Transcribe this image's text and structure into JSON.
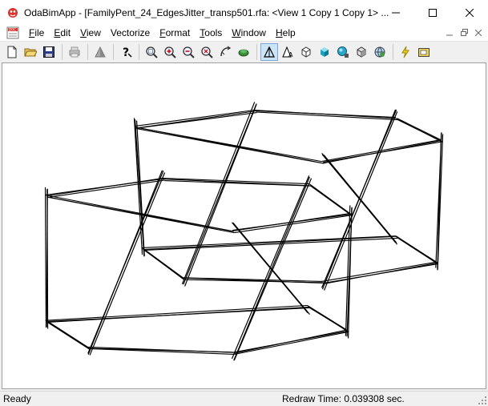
{
  "window": {
    "title": "OdaBimApp - [FamilyPent_24_EdgesJitter_transp501.rfa: <View 1 Copy 1 Copy 1> ...",
    "minimize_icon": "minimize-icon",
    "maximize_icon": "maximize-icon",
    "close_icon": "close-icon"
  },
  "menu": {
    "items": [
      {
        "key": "F",
        "rest": "ile"
      },
      {
        "key": "E",
        "rest": "dit"
      },
      {
        "key": "V",
        "rest": "iew"
      },
      {
        "key": "",
        "rest": "Vectorize"
      },
      {
        "key": "F",
        "rest": "ormat",
        "underline_index": 1
      },
      {
        "key": "T",
        "rest": "ools"
      },
      {
        "key": "W",
        "rest": "indow"
      },
      {
        "key": "H",
        "rest": "elp"
      }
    ]
  },
  "toolbar": {
    "buttons": [
      "new-icon",
      "open-icon",
      "save-icon",
      "print-icon",
      "render-icon",
      "help-icon",
      "zoom-window-icon",
      "zoom-in-icon",
      "zoom-out-icon",
      "zoom-extents-icon",
      "orbit-icon",
      "walk-icon",
      "wireframe-icon",
      "hidden-line-icon",
      "flat-shaded-icon",
      "gouraud-icon",
      "shaded-edges-icon",
      "realistic-icon",
      "sphere-icon",
      "lightning-icon",
      "paste-icon"
    ]
  },
  "status": {
    "left": "Ready",
    "right": "Redraw Time: 0.039308 sec."
  },
  "colors": {
    "window_bg": "#f0f0f0",
    "viewport_bg": "#ffffff",
    "active_tool": "#cce4f7"
  }
}
